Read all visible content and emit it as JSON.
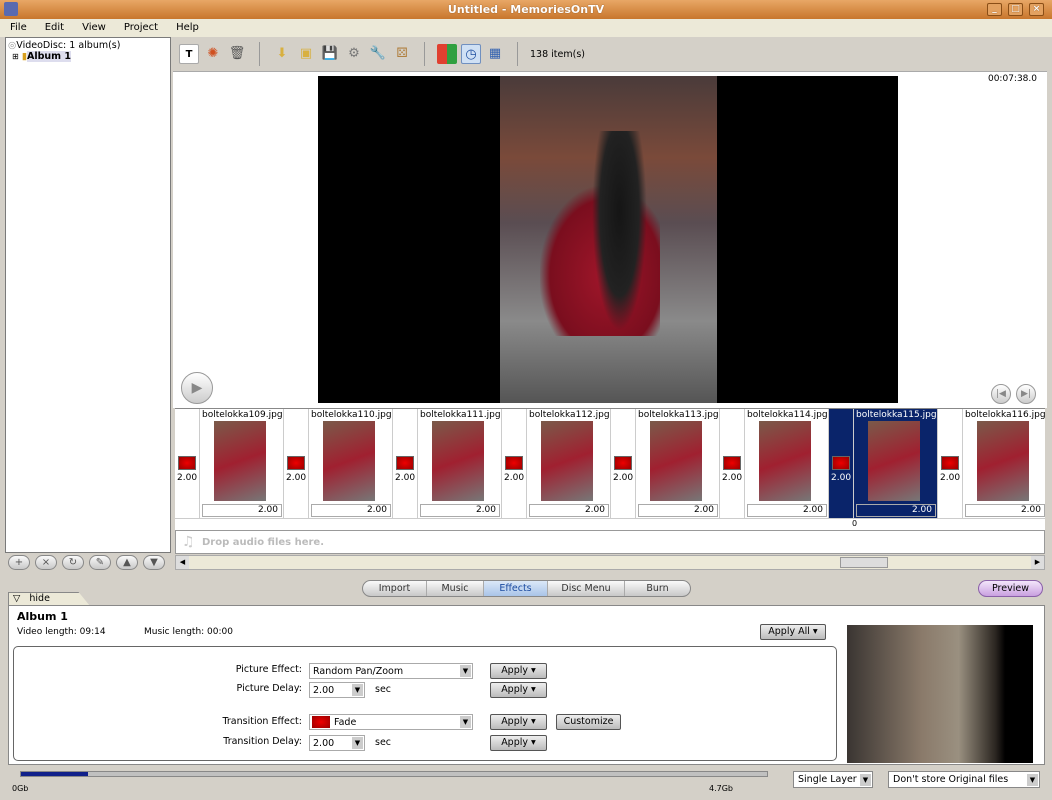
{
  "window": {
    "title": "Untitled - MemoriesOnTV"
  },
  "menu": [
    "File",
    "Edit",
    "View",
    "Project",
    "Help"
  ],
  "tree": {
    "root": "VideoDisc: 1 album(s)",
    "album": "Album 1"
  },
  "toolbar": {
    "item_count": "138 item(s)"
  },
  "preview": {
    "time": "00:07:38.0"
  },
  "timeline": {
    "items": [
      {
        "name": "boltelokka109.jpg",
        "delay": "2.00",
        "transition": "2.00"
      },
      {
        "name": "boltelokka110.jpg",
        "delay": "2.00",
        "transition": "2.00"
      },
      {
        "name": "boltelokka111.jpg",
        "delay": "2.00",
        "transition": "2.00"
      },
      {
        "name": "boltelokka112.jpg",
        "delay": "2.00",
        "transition": "2.00"
      },
      {
        "name": "boltelokka113.jpg",
        "delay": "2.00",
        "transition": "2.00"
      },
      {
        "name": "boltelokka114.jpg",
        "delay": "2.00",
        "transition": "2.00"
      },
      {
        "name": "boltelokka115.jpg",
        "delay": "2.00",
        "transition": "2.00",
        "selected": true
      },
      {
        "name": "boltelokka116.jpg",
        "delay": "2.00",
        "transition": "2.00"
      }
    ],
    "ruler_mark": "0",
    "audio_placeholder": "Drop audio files here."
  },
  "tabs": [
    {
      "label": "Import"
    },
    {
      "label": "Music"
    },
    {
      "label": "Effects",
      "active": true
    },
    {
      "label": "Disc Menu"
    },
    {
      "label": "Burn"
    }
  ],
  "preview_button": "Preview",
  "hide_tab": "hide",
  "panel": {
    "album": "Album 1",
    "video_length": "Video length: 09:14",
    "music_length": "Music length: 00:00",
    "apply_all": "Apply All",
    "picture_effect_label": "Picture Effect:",
    "picture_effect": "Random Pan/Zoom",
    "picture_delay_label": "Picture Delay:",
    "picture_delay": "2.00",
    "transition_effect_label": "Transition Effect:",
    "transition_effect": "Fade",
    "transition_delay_label": "Transition Delay:",
    "transition_delay": "2.00",
    "sec": "sec",
    "apply": "Apply",
    "customize": "Customize"
  },
  "storage": {
    "used_fraction": 0.09,
    "start_label": "0Gb",
    "end_label": "4.7Gb",
    "layer": "Single Layer",
    "original_files": "Don't store Original files"
  }
}
